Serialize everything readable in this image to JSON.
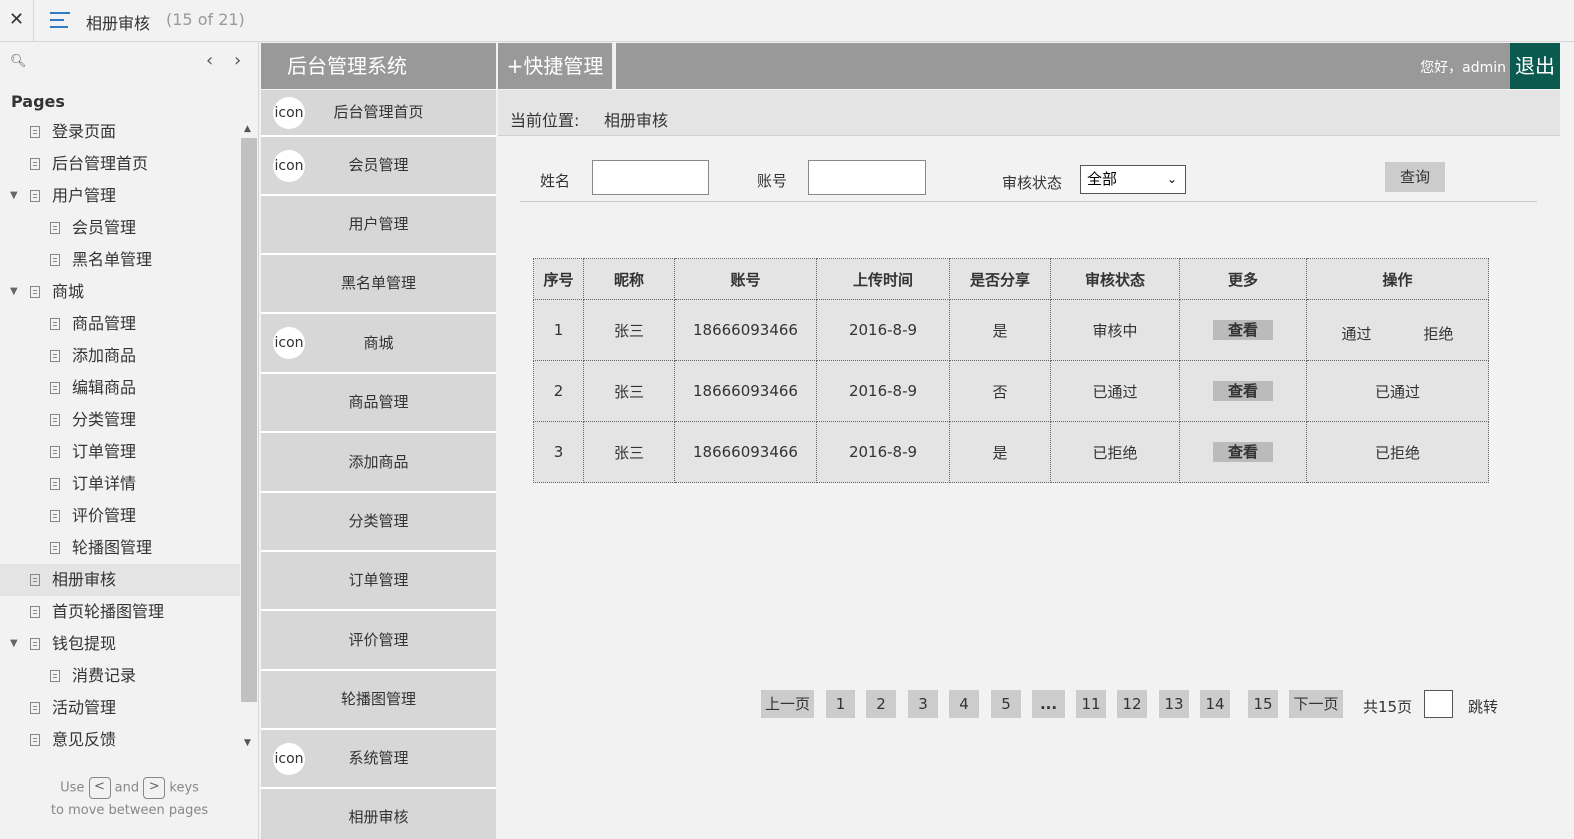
{
  "topbar": {
    "close_glyph": "✕",
    "page_title": "相册审核",
    "page_count": "(15 of 21)"
  },
  "pages_panel": {
    "heading": "Pages",
    "items": [
      {
        "label": "登录页面",
        "level": 1,
        "expanded": null
      },
      {
        "label": "后台管理首页",
        "level": 1,
        "expanded": null
      },
      {
        "label": "用户管理",
        "level": 1,
        "expanded": true
      },
      {
        "label": "会员管理",
        "level": 2,
        "expanded": null
      },
      {
        "label": "黑名单管理",
        "level": 2,
        "expanded": null
      },
      {
        "label": "商城",
        "level": 1,
        "expanded": true
      },
      {
        "label": "商品管理",
        "level": 2,
        "expanded": null
      },
      {
        "label": "添加商品",
        "level": 2,
        "expanded": null
      },
      {
        "label": "编辑商品",
        "level": 2,
        "expanded": null
      },
      {
        "label": "分类管理",
        "level": 2,
        "expanded": null
      },
      {
        "label": "订单管理",
        "level": 2,
        "expanded": null
      },
      {
        "label": "订单详情",
        "level": 2,
        "expanded": null
      },
      {
        "label": "评价管理",
        "level": 2,
        "expanded": null
      },
      {
        "label": "轮播图管理",
        "level": 2,
        "expanded": null
      },
      {
        "label": "相册审核",
        "level": 1,
        "expanded": null,
        "active": true
      },
      {
        "label": "首页轮播图管理",
        "level": 1,
        "expanded": null
      },
      {
        "label": "钱包提现",
        "level": 1,
        "expanded": true
      },
      {
        "label": "消费记录",
        "level": 2,
        "expanded": null
      },
      {
        "label": "活动管理",
        "level": 1,
        "expanded": null
      },
      {
        "label": "意见反馈",
        "level": 1,
        "expanded": null
      }
    ],
    "hint_use": "Use",
    "hint_and": "and",
    "hint_keys": "keys",
    "hint_line2": "to move between pages",
    "key_prev": "<",
    "key_next": ">"
  },
  "admin_header": {
    "system_title": "后台管理系统",
    "quick_manage": "+快捷管理",
    "greeting": "您好，admin",
    "logout": "退出"
  },
  "admin_nav": [
    {
      "label": "后台管理首页",
      "icon": "icon",
      "height": 47
    },
    {
      "label": "会员管理",
      "icon": "icon",
      "height": 59
    },
    {
      "label": "用户管理",
      "icon": null,
      "height": 59
    },
    {
      "label": "黑名单管理",
      "icon": null,
      "height": 59
    },
    {
      "label": "商城",
      "icon": "icon",
      "height": 60
    },
    {
      "label": "商品管理",
      "icon": null,
      "height": 59
    },
    {
      "label": "添加商品",
      "icon": null,
      "height": 60
    },
    {
      "label": "分类管理",
      "icon": null,
      "height": 59
    },
    {
      "label": "订单管理",
      "icon": null,
      "height": 59
    },
    {
      "label": "评价管理",
      "icon": null,
      "height": 60
    },
    {
      "label": "轮播图管理",
      "icon": null,
      "height": 59
    },
    {
      "label": "系统管理",
      "icon": "icon",
      "height": 59
    },
    {
      "label": "相册审核",
      "icon": null,
      "height": 59
    }
  ],
  "breadcrumb": {
    "label": "当前位置:",
    "value": "相册审核"
  },
  "filters": {
    "name_label": "姓名",
    "name_value": "",
    "account_label": "账号",
    "account_value": "",
    "status_label": "审核状态",
    "status_selected": "全部",
    "query_button": "查询"
  },
  "table": {
    "columns": [
      "序号",
      "昵称",
      "账号",
      "上传时间",
      "是否分享",
      "审核状态",
      "更多",
      "操作"
    ],
    "rows": [
      {
        "no": "1",
        "nickname": "张三",
        "account": "18666093466",
        "upload_time": "2016-8-9",
        "shared": "是",
        "status": "审核中",
        "more": "查看",
        "actions": [
          "通过",
          "拒绝"
        ]
      },
      {
        "no": "2",
        "nickname": "张三",
        "account": "18666093466",
        "upload_time": "2016-8-9",
        "shared": "否",
        "status": "已通过",
        "more": "查看",
        "actions": [
          "已通过"
        ]
      },
      {
        "no": "3",
        "nickname": "张三",
        "account": "18666093466",
        "upload_time": "2016-8-9",
        "shared": "是",
        "status": "已拒绝",
        "more": "查看",
        "actions": [
          "已拒绝"
        ]
      }
    ]
  },
  "pagination": {
    "prev": "上一页",
    "pages": [
      "1",
      "2",
      "3",
      "4",
      "5",
      "...",
      "11",
      "12",
      "13",
      "14",
      "15"
    ],
    "next": "下一页",
    "total": "共15页",
    "jump": "跳转"
  }
}
